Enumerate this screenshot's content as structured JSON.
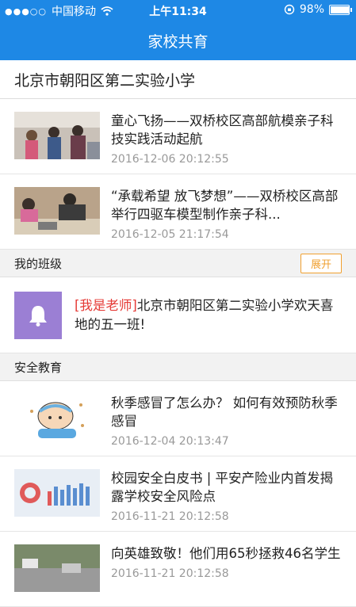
{
  "status_bar": {
    "carrier": "中国移动",
    "time": "上午11:34",
    "battery": "98%",
    "battery_level": 0.98
  },
  "header": {
    "title": "家校共育"
  },
  "school_name": "北京市朝阳区第二实验小学",
  "news": [
    {
      "title": "童心飞扬——双桥校区高部航模亲子科技实践活动起航",
      "date": "2016-12-06 20:12:55"
    },
    {
      "title": "“承载希望 放飞梦想”——双桥校区高部举行四驱车模型制作亲子科...",
      "date": "2016-12-05 21:17:54"
    }
  ],
  "my_class": {
    "label": "我的班级",
    "expand_label": "展开",
    "tag": "[我是老师]",
    "message": "北京市朝阳区第二实验小学欢天喜地的五一班!",
    "icon_color": "#9b7fd4"
  },
  "safety": {
    "label": "安全教育",
    "items": [
      {
        "title": "秋季感冒了怎么办？ 如何有效预防秋季感冒",
        "date": "2016-12-04 20:13:47"
      },
      {
        "title": "校园安全白皮书 | 平安产险业内首发揭露学校安全风险点",
        "date": "2016-11-21 20:12:58"
      },
      {
        "title": "向英雄致敬！他们用65秒拯救46名学生",
        "date": "2016-11-21 20:12:58"
      }
    ]
  },
  "colors": {
    "primary": "#1e88e5",
    "accent": "#f0a030",
    "tag": "#e53935"
  }
}
